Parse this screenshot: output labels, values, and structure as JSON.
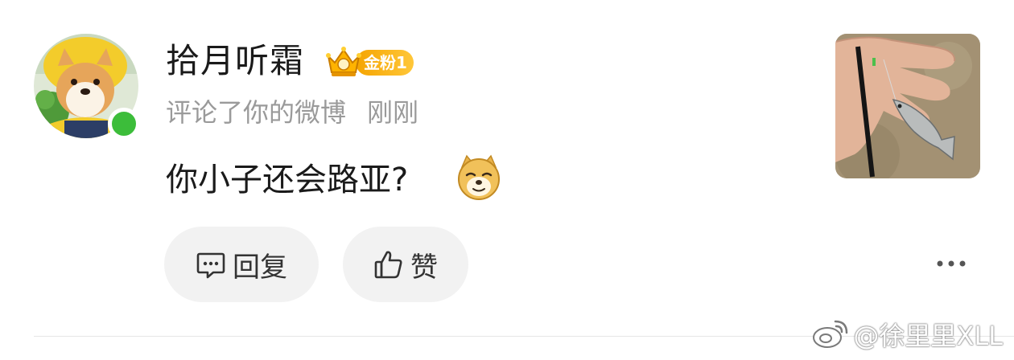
{
  "user": {
    "name": "拾月听霜",
    "badge_label": "金粉1",
    "action_text": "评论了你的微博",
    "time": "刚刚",
    "online": true,
    "badge_color": "#f5a400",
    "online_color": "#3cbd3a"
  },
  "comment": {
    "text": "你小子还会路亚?",
    "emoji": "doge-emoji"
  },
  "actions": {
    "reply_label": "回复",
    "like_label": "赞"
  },
  "post_thumbnail": {
    "subject": "fish-on-hook-photo"
  },
  "watermark": {
    "text": "@徐里里XLL"
  }
}
